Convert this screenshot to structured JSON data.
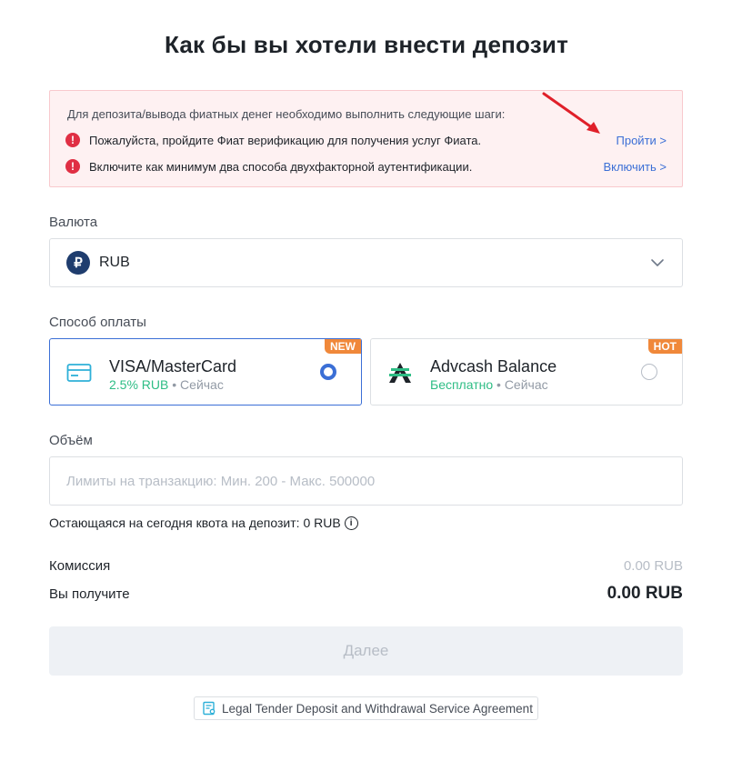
{
  "page": {
    "title": "Как бы вы хотели внести депозит"
  },
  "notice": {
    "heading": "Для депозита/вывода фиатных денег необходимо выполнить следующие шаги:",
    "items": [
      {
        "text": "Пожалуйста, пройдите Фиат верификацию для получения услуг Фиата.",
        "link": "Пройти >"
      },
      {
        "text": "Включите как минимум два способа двухфакторной аутентификации.",
        "link": "Включить >"
      }
    ],
    "colors": {
      "warn": "#e02f44",
      "link": "#3b6fd6",
      "background": "#fef1f2"
    }
  },
  "currency": {
    "label": "Валюта",
    "selected": "RUB",
    "icon_glyph": "₽",
    "icon": "ruble-icon"
  },
  "payment": {
    "label": "Способ оплаты",
    "methods": [
      {
        "name": "VISA/MasterCard",
        "fee": "2.5% RUB",
        "time": "• Сейчас",
        "badge": "NEW",
        "selected": true,
        "icon": "credit-card-icon"
      },
      {
        "name": "Advcash Balance",
        "fee": "Бесплатно",
        "time": "• Сейчас",
        "badge": "HOT",
        "selected": false,
        "icon": "advcash-logo-icon"
      }
    ]
  },
  "amount": {
    "label": "Объём",
    "placeholder": "Лимиты на транзакцию: Мин. 200 - Макс. 500000",
    "value": ""
  },
  "quota": {
    "text": "Остающаяся на сегодня квота на депозит: 0 RUB",
    "icon_glyph": "i"
  },
  "summary": {
    "fee_label": "Комиссия",
    "fee_value": "0.00 RUB",
    "receive_label": "Вы получите",
    "receive_value": "0.00 RUB"
  },
  "actions": {
    "next_label": "Далее"
  },
  "agreement": {
    "text": "Legal Tender Deposit and Withdrawal Service Agreement",
    "icon": "document-icon"
  }
}
